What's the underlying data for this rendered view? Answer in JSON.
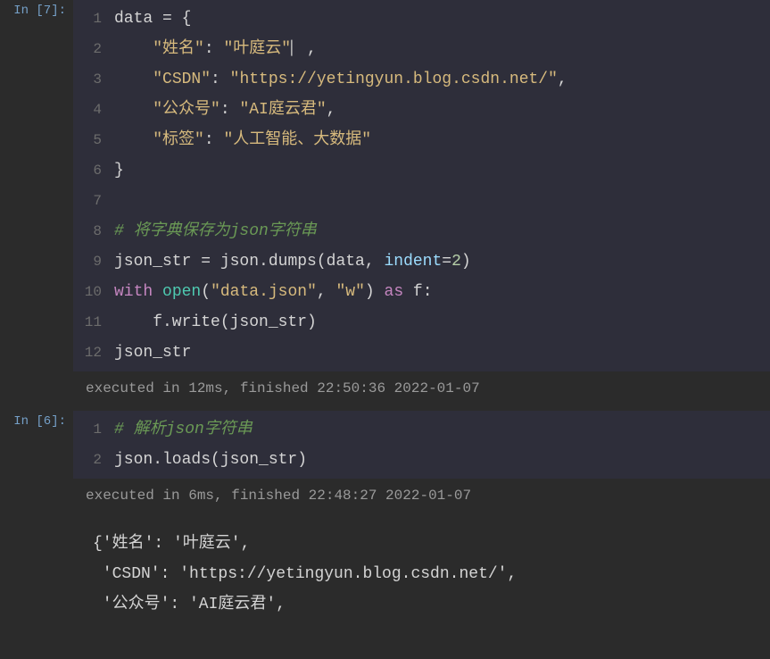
{
  "cells": [
    {
      "prompt": "In [7]:",
      "line_numbers": [
        "1",
        "2",
        "3",
        "4",
        "5",
        "6",
        "7",
        "8",
        "9",
        "10",
        "11",
        "12"
      ],
      "code": {
        "l1": {
          "a": "data ",
          "b": "=",
          "c": " {"
        },
        "l2": {
          "a": "    ",
          "b": "\"姓名\"",
          "c": ": ",
          "d": "\"叶庭云\"",
          "e": ","
        },
        "l3": {
          "a": "    ",
          "b": "\"CSDN\"",
          "c": ": ",
          "d": "\"https://yetingyun.blog.csdn.net/\"",
          "e": ","
        },
        "l4": {
          "a": "    ",
          "b": "\"公众号\"",
          "c": ": ",
          "d": "\"AI庭云君\"",
          "e": ","
        },
        "l5": {
          "a": "    ",
          "b": "\"标签\"",
          "c": ": ",
          "d": "\"人工智能、大数据\""
        },
        "l6": {
          "a": "}"
        },
        "l7": {
          "a": ""
        },
        "l8": {
          "a": "# 将字典保存为json字符串"
        },
        "l9": {
          "a": "json_str ",
          "b": "=",
          "c": " json.dumps(data, ",
          "d": "indent",
          "e": "=",
          "f": "2",
          "g": ")"
        },
        "l10": {
          "a": "with",
          "b": " ",
          "c": "open",
          "d": "(",
          "e": "\"data.json\"",
          "f": ", ",
          "g": "\"w\"",
          "h": ") ",
          "i": "as",
          "j": " f:"
        },
        "l11": {
          "a": "    f.write(json_str)"
        },
        "l12": {
          "a": "json_str"
        }
      },
      "status": "executed in 12ms, finished 22:50:36 2022-01-07"
    },
    {
      "prompt": "In [6]:",
      "line_numbers": [
        "1",
        "2"
      ],
      "code": {
        "l1": {
          "a": "# 解析json字符串"
        },
        "l2": {
          "a": "json.loads(json_str)"
        }
      },
      "status": "executed in 6ms, finished 22:48:27 2022-01-07",
      "output": [
        "{'姓名': '叶庭云',",
        " 'CSDN': 'https://yetingyun.blog.csdn.net/',",
        " '公众号': 'AI庭云君',"
      ]
    }
  ]
}
